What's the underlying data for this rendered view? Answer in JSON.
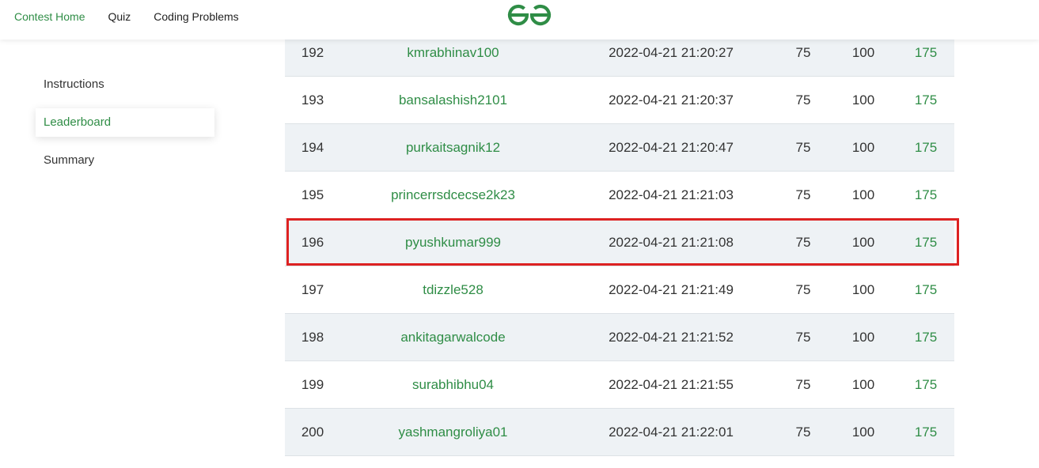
{
  "nav": {
    "contest_home": "Contest Home",
    "quiz": "Quiz",
    "coding_problems": "Coding Problems"
  },
  "logo": {
    "icon": "gfg-logo-icon",
    "color": "#2f8d46"
  },
  "sidebar": {
    "items": [
      {
        "label": "Instructions",
        "active": false
      },
      {
        "label": "Leaderboard",
        "active": true
      },
      {
        "label": "Summary",
        "active": false
      }
    ]
  },
  "leaderboard": {
    "rows": [
      {
        "rank": "192",
        "user": "kmrabhinav100",
        "time": "2022-04-21 21:20:27",
        "score1": "75",
        "score2": "100",
        "total": "175"
      },
      {
        "rank": "193",
        "user": "bansalashish2101",
        "time": "2022-04-21 21:20:37",
        "score1": "75",
        "score2": "100",
        "total": "175"
      },
      {
        "rank": "194",
        "user": "purkaitsagnik12",
        "time": "2022-04-21 21:20:47",
        "score1": "75",
        "score2": "100",
        "total": "175"
      },
      {
        "rank": "195",
        "user": "princerrsdcecse2k23",
        "time": "2022-04-21 21:21:03",
        "score1": "75",
        "score2": "100",
        "total": "175"
      },
      {
        "rank": "196",
        "user": "pyushkumar999",
        "time": "2022-04-21 21:21:08",
        "score1": "75",
        "score2": "100",
        "total": "175"
      },
      {
        "rank": "197",
        "user": "tdizzle528",
        "time": "2022-04-21 21:21:49",
        "score1": "75",
        "score2": "100",
        "total": "175"
      },
      {
        "rank": "198",
        "user": "ankitagarwalcode",
        "time": "2022-04-21 21:21:52",
        "score1": "75",
        "score2": "100",
        "total": "175"
      },
      {
        "rank": "199",
        "user": "surabhibhu04",
        "time": "2022-04-21 21:21:55",
        "score1": "75",
        "score2": "100",
        "total": "175"
      },
      {
        "rank": "200",
        "user": "yashmangroliya01",
        "time": "2022-04-21 21:22:01",
        "score1": "75",
        "score2": "100",
        "total": "175"
      }
    ],
    "highlighted_rank": "196"
  },
  "colors": {
    "accent": "#2f8d46",
    "highlight_border": "#dd2222",
    "row_alt": "#eef2f5"
  }
}
